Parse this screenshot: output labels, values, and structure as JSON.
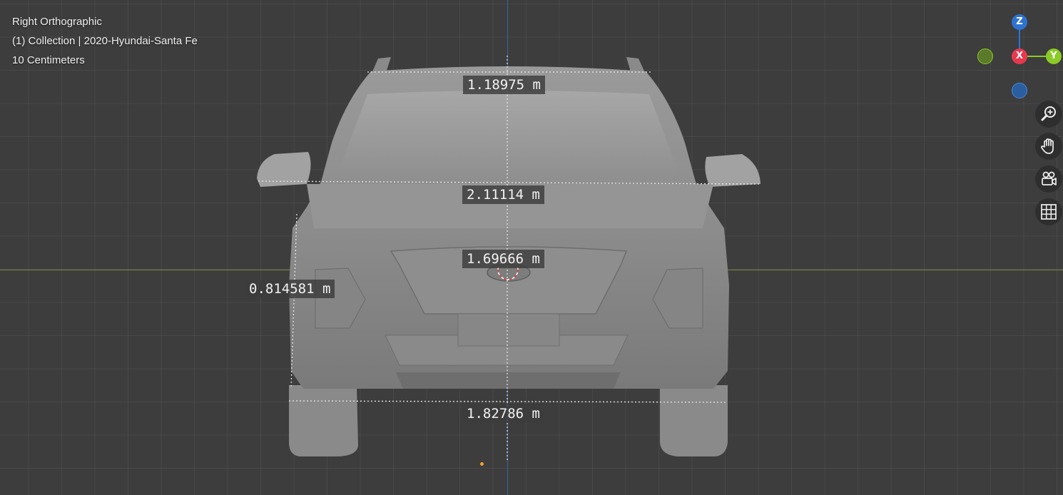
{
  "viewport": {
    "view_name": "Right Orthographic",
    "collection_label": "(1) Collection | 2020-Hyundai-Santa Fe",
    "grid_scale": "10 Centimeters"
  },
  "measurements": {
    "roof_width": "1.18975 m",
    "mirror_width": "2.11114 m",
    "height": "1.69666 m",
    "side_height": "0.814581 m",
    "track_width": "1.82786 m"
  },
  "gizmo": {
    "z_label": "Z",
    "x_label": "X",
    "y_label": "Y",
    "colors": {
      "z": "#2e73d1",
      "x": "#e8384f",
      "y": "#8acb27",
      "neg_y": "#5a7a2a",
      "neg_z": "#2a5ea0"
    }
  },
  "nav_buttons": {
    "zoom_icon": "zoom-icon",
    "pan_icon": "hand-icon",
    "camera_icon": "camera-icon",
    "ortho_icon": "grid-icon"
  }
}
